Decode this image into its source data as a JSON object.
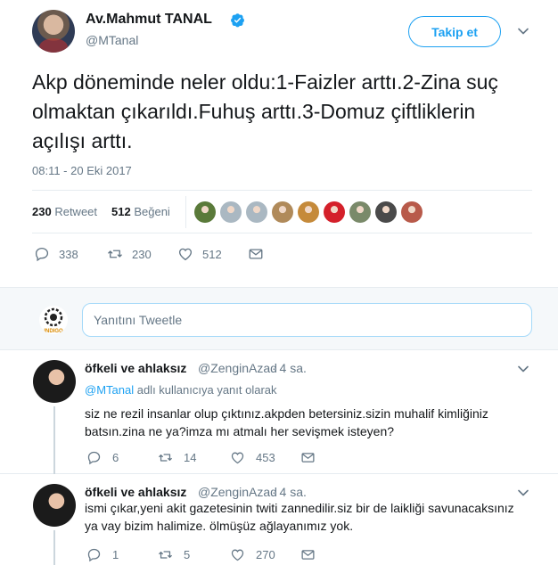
{
  "tweet": {
    "author_name": "Av.Mahmut TANAL",
    "author_handle": "@MTanal",
    "follow_label": "Takip et",
    "text": "Akp döneminde neler oldu:1-Faizler arttı.2-Zina suç olmaktan çıkarıldı.Fuhuş arttı.3-Domuz çiftliklerin açılışı arttı.",
    "timestamp": "08:11 - 20 Eki 2017",
    "retweets_count": "230",
    "retweets_label": "Retweet",
    "likes_count": "512",
    "likes_label": "Beğeni",
    "actions": {
      "replies": "338",
      "retweets": "230",
      "likes": "512"
    },
    "liker_colors": [
      "#5a7a3a",
      "#aab8c2",
      "#aab8c2",
      "#b08a5a",
      "#c58a3a",
      "#d4202a",
      "#7a8a6a",
      "#4a4a4a",
      "#b85a4a"
    ]
  },
  "reply_box": {
    "placeholder": "Yanıtını Tweetle",
    "avatar_text": "INDIGO"
  },
  "replies": [
    {
      "name": "öfkeli ve ahlaksız",
      "handle": "@ZenginAzad",
      "time": "· 4 sa.",
      "replying_mention": "@MTanal",
      "replying_suffix": " adlı kullanıcıya yanıt olarak",
      "text": "siz ne rezil insanlar olup çıktınız.akpden betersiniz.sizin muhalif kimliğiniz batsın.zina ne ya?imza mı atmalı her sevişmek isteyen?",
      "replies": "6",
      "retweets": "14",
      "likes": "453"
    },
    {
      "name": "öfkeli ve ahlaksız",
      "handle": "@ZenginAzad",
      "time": "· 4 sa.",
      "text": "ismi çıkar,yeni akit gazetesinin twiti zannedilir.siz bir de laikliği savunacaksınız ya vay bizim halimize. ölmüşüz ağlayanımız yok.",
      "replies": "1",
      "retweets": "5",
      "likes": "270"
    }
  ],
  "colors": {
    "accent": "#1da1f2",
    "secondary_text": "#657786",
    "border": "#e6ecf0"
  }
}
